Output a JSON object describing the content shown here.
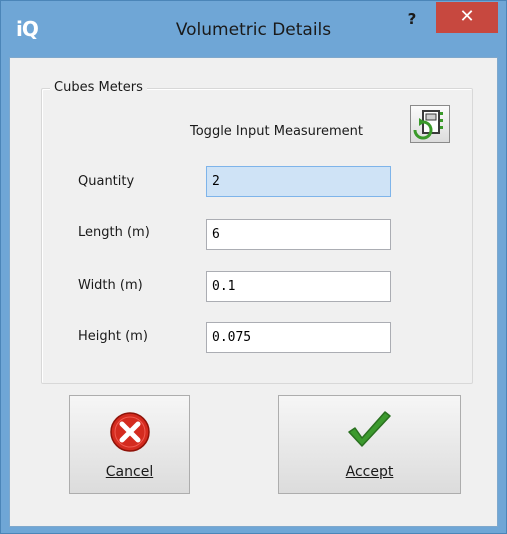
{
  "window": {
    "logo": "iQ",
    "title": "Volumetric Details",
    "help_label": "?",
    "close_label": "✕"
  },
  "group": {
    "legend": "Cubes Meters",
    "toggle_label": "Toggle Input Measurement"
  },
  "fields": {
    "quantity": {
      "label": "Quantity",
      "value": "2"
    },
    "length": {
      "label": "Length (m)",
      "value": "6"
    },
    "width": {
      "label": "Width (m)",
      "value": "0.1"
    },
    "height": {
      "label": "Height (m)",
      "value": "0.075"
    }
  },
  "buttons": {
    "cancel": {
      "label": "Cancel",
      "icon": "error-x-icon"
    },
    "accept": {
      "label": "Accept",
      "icon": "checkmark-icon"
    }
  },
  "colors": {
    "titlebar": "#6fa6d6",
    "close": "#c7483f",
    "focused_field": "#cfe3f6"
  }
}
